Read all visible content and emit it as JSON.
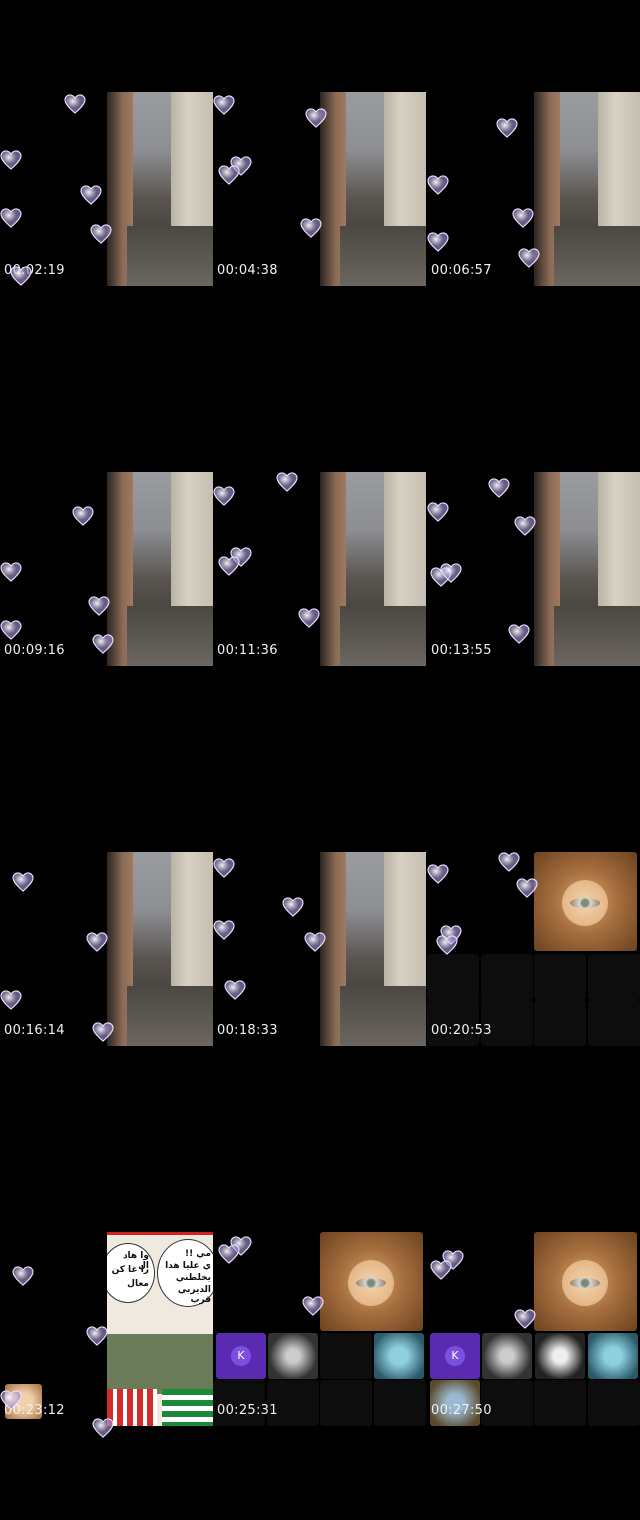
{
  "timestamps": [
    "00:02:19",
    "00:04:38",
    "00:06:57",
    "00:09:16",
    "00:11:36",
    "00:13:55",
    "00:16:14",
    "00:18:33",
    "00:20:53",
    "00:23:12",
    "00:25:31",
    "00:27:50"
  ],
  "avatar_letter": "K",
  "meme_texts": {
    "left_bubble": [
      "وا هاد ال",
      "را غا كن",
      "معال"
    ],
    "right_bubble": [
      "مي !!",
      "ي عليا هدا",
      "يخلطني",
      "الديربي قرب"
    ]
  },
  "colors": {
    "background": "#000000",
    "avatar": "#5a2bb0"
  },
  "icons": [
    "heart-bubble-icon"
  ]
}
